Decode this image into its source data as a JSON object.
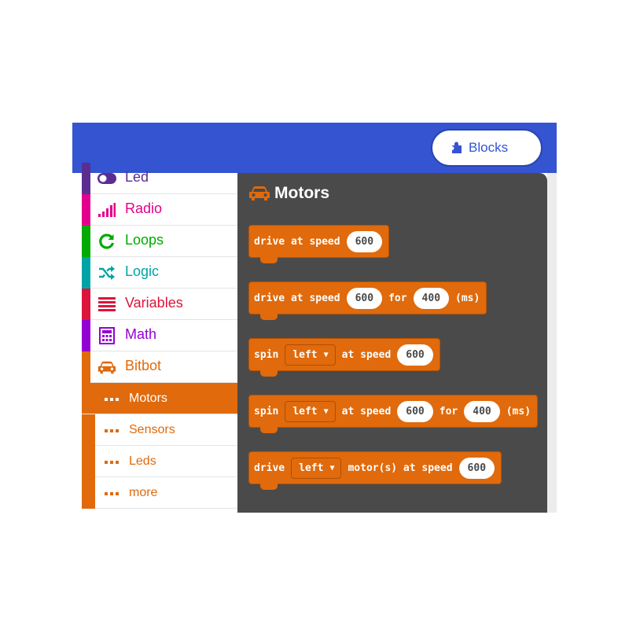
{
  "header": {
    "blocks_button": {
      "label": "Blocks",
      "icon": "puzzle-icon"
    }
  },
  "colors": {
    "topbar": "#3454d1",
    "flyout_bg": "#4a4a4a",
    "bitbot": "#e06a0c"
  },
  "categories": [
    {
      "label": "Led",
      "icon": "toggle-icon",
      "color": "#5c2d91"
    },
    {
      "label": "Radio",
      "icon": "signal-bars-icon",
      "color": "#e3008c"
    },
    {
      "label": "Loops",
      "icon": "refresh-icon",
      "color": "#00aa00"
    },
    {
      "label": "Logic",
      "icon": "shuffle-icon",
      "color": "#00a4a6"
    },
    {
      "label": "Variables",
      "icon": "list-icon",
      "color": "#dc143c"
    },
    {
      "label": "Math",
      "icon": "calculator-icon",
      "color": "#9400d3"
    },
    {
      "label": "Bitbot",
      "icon": "car-icon",
      "color": "#e06a0c"
    }
  ],
  "subcategories": [
    {
      "label": "Motors",
      "selected": true
    },
    {
      "label": "Sensors",
      "selected": false
    },
    {
      "label": "Leds",
      "selected": false
    },
    {
      "label": "more",
      "selected": false
    }
  ],
  "flyout": {
    "title": "Motors",
    "title_icon": "car-icon",
    "blocks": [
      {
        "parts": [
          {
            "t": "drive at speed"
          },
          {
            "num": "600"
          }
        ]
      },
      {
        "parts": [
          {
            "t": "drive at speed"
          },
          {
            "num": "600"
          },
          {
            "t": "for"
          },
          {
            "num": "400"
          },
          {
            "t": "(ms)"
          }
        ]
      },
      {
        "parts": [
          {
            "t": "spin"
          },
          {
            "dd": "left"
          },
          {
            "t": "at speed"
          },
          {
            "num": "600"
          }
        ]
      },
      {
        "parts": [
          {
            "t": "spin"
          },
          {
            "dd": "left"
          },
          {
            "t": "at speed"
          },
          {
            "num": "600"
          },
          {
            "t": "for"
          },
          {
            "num": "400"
          },
          {
            "t": "(ms)"
          }
        ]
      },
      {
        "parts": [
          {
            "t": "drive"
          },
          {
            "dd": "left"
          },
          {
            "t": "motor(s) at speed"
          },
          {
            "num": "600"
          }
        ]
      }
    ]
  }
}
